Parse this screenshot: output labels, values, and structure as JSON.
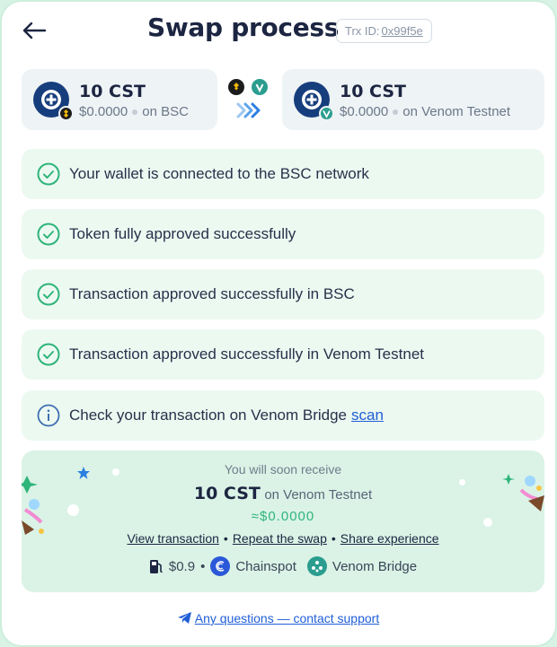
{
  "header": {
    "title": "Swap process",
    "trx_label": "Trx ID:",
    "trx_id": "0x99f5e"
  },
  "from_token": {
    "amount": "10 CST",
    "usd": "$0.0000",
    "network": "on BSC"
  },
  "to_token": {
    "amount": "10 CST",
    "usd": "$0.0000",
    "network": "on Venom Testnet"
  },
  "steps": [
    {
      "text": "Your wallet is connected to the BSC network"
    },
    {
      "text": "Token fully approved successfully"
    },
    {
      "text": "Transaction approved successfully in BSC"
    },
    {
      "text": "Transaction approved successfully in Venom Testnet"
    }
  ],
  "info": {
    "text": "Check your transaction on Venom Bridge",
    "link": "scan"
  },
  "receive": {
    "title": "You will soon receive",
    "amount": "10 CST",
    "network": "on Venom Testnet",
    "usd": "≈$0.0000",
    "links": [
      "View transaction",
      "Repeat the swap",
      "Share experience"
    ],
    "gas": "$0.9",
    "provider_1": "Chainspot",
    "provider_2": "Venom Bridge"
  },
  "support": "Any questions — contact support",
  "colors": {
    "accent_green": "#2fb47a",
    "link_blue": "#1f5ed6",
    "success_bg": "#ecf9f1"
  }
}
